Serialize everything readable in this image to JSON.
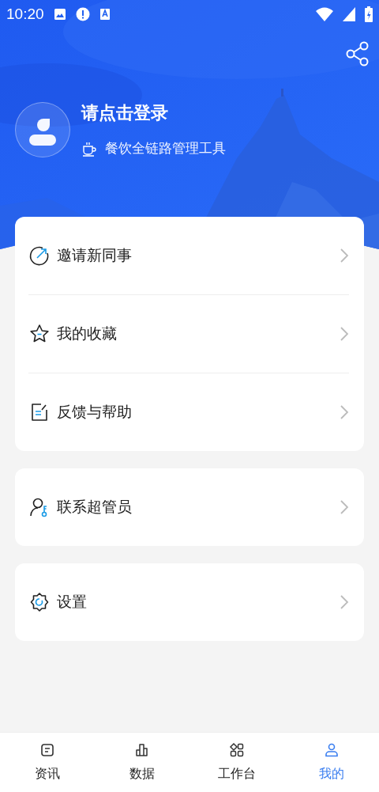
{
  "status_bar": {
    "time": "10:20"
  },
  "profile": {
    "title": "请点击登录",
    "subtitle": "餐饮全链路管理工具"
  },
  "menu_groups": [
    {
      "items": [
        {
          "kind": "invite",
          "label": "邀请新同事"
        },
        {
          "kind": "favorite",
          "label": "我的收藏"
        },
        {
          "kind": "feedback",
          "label": "反馈与帮助"
        }
      ]
    },
    {
      "items": [
        {
          "kind": "admin",
          "label": "联系超管员"
        }
      ]
    },
    {
      "items": [
        {
          "kind": "settings",
          "label": "设置"
        }
      ]
    }
  ],
  "tabs": [
    {
      "kind": "news",
      "label": "资讯",
      "selected": false
    },
    {
      "kind": "data",
      "label": "数据",
      "selected": false
    },
    {
      "kind": "workbench",
      "label": "工作台",
      "selected": false
    },
    {
      "kind": "mine",
      "label": "我的",
      "selected": true
    }
  ]
}
